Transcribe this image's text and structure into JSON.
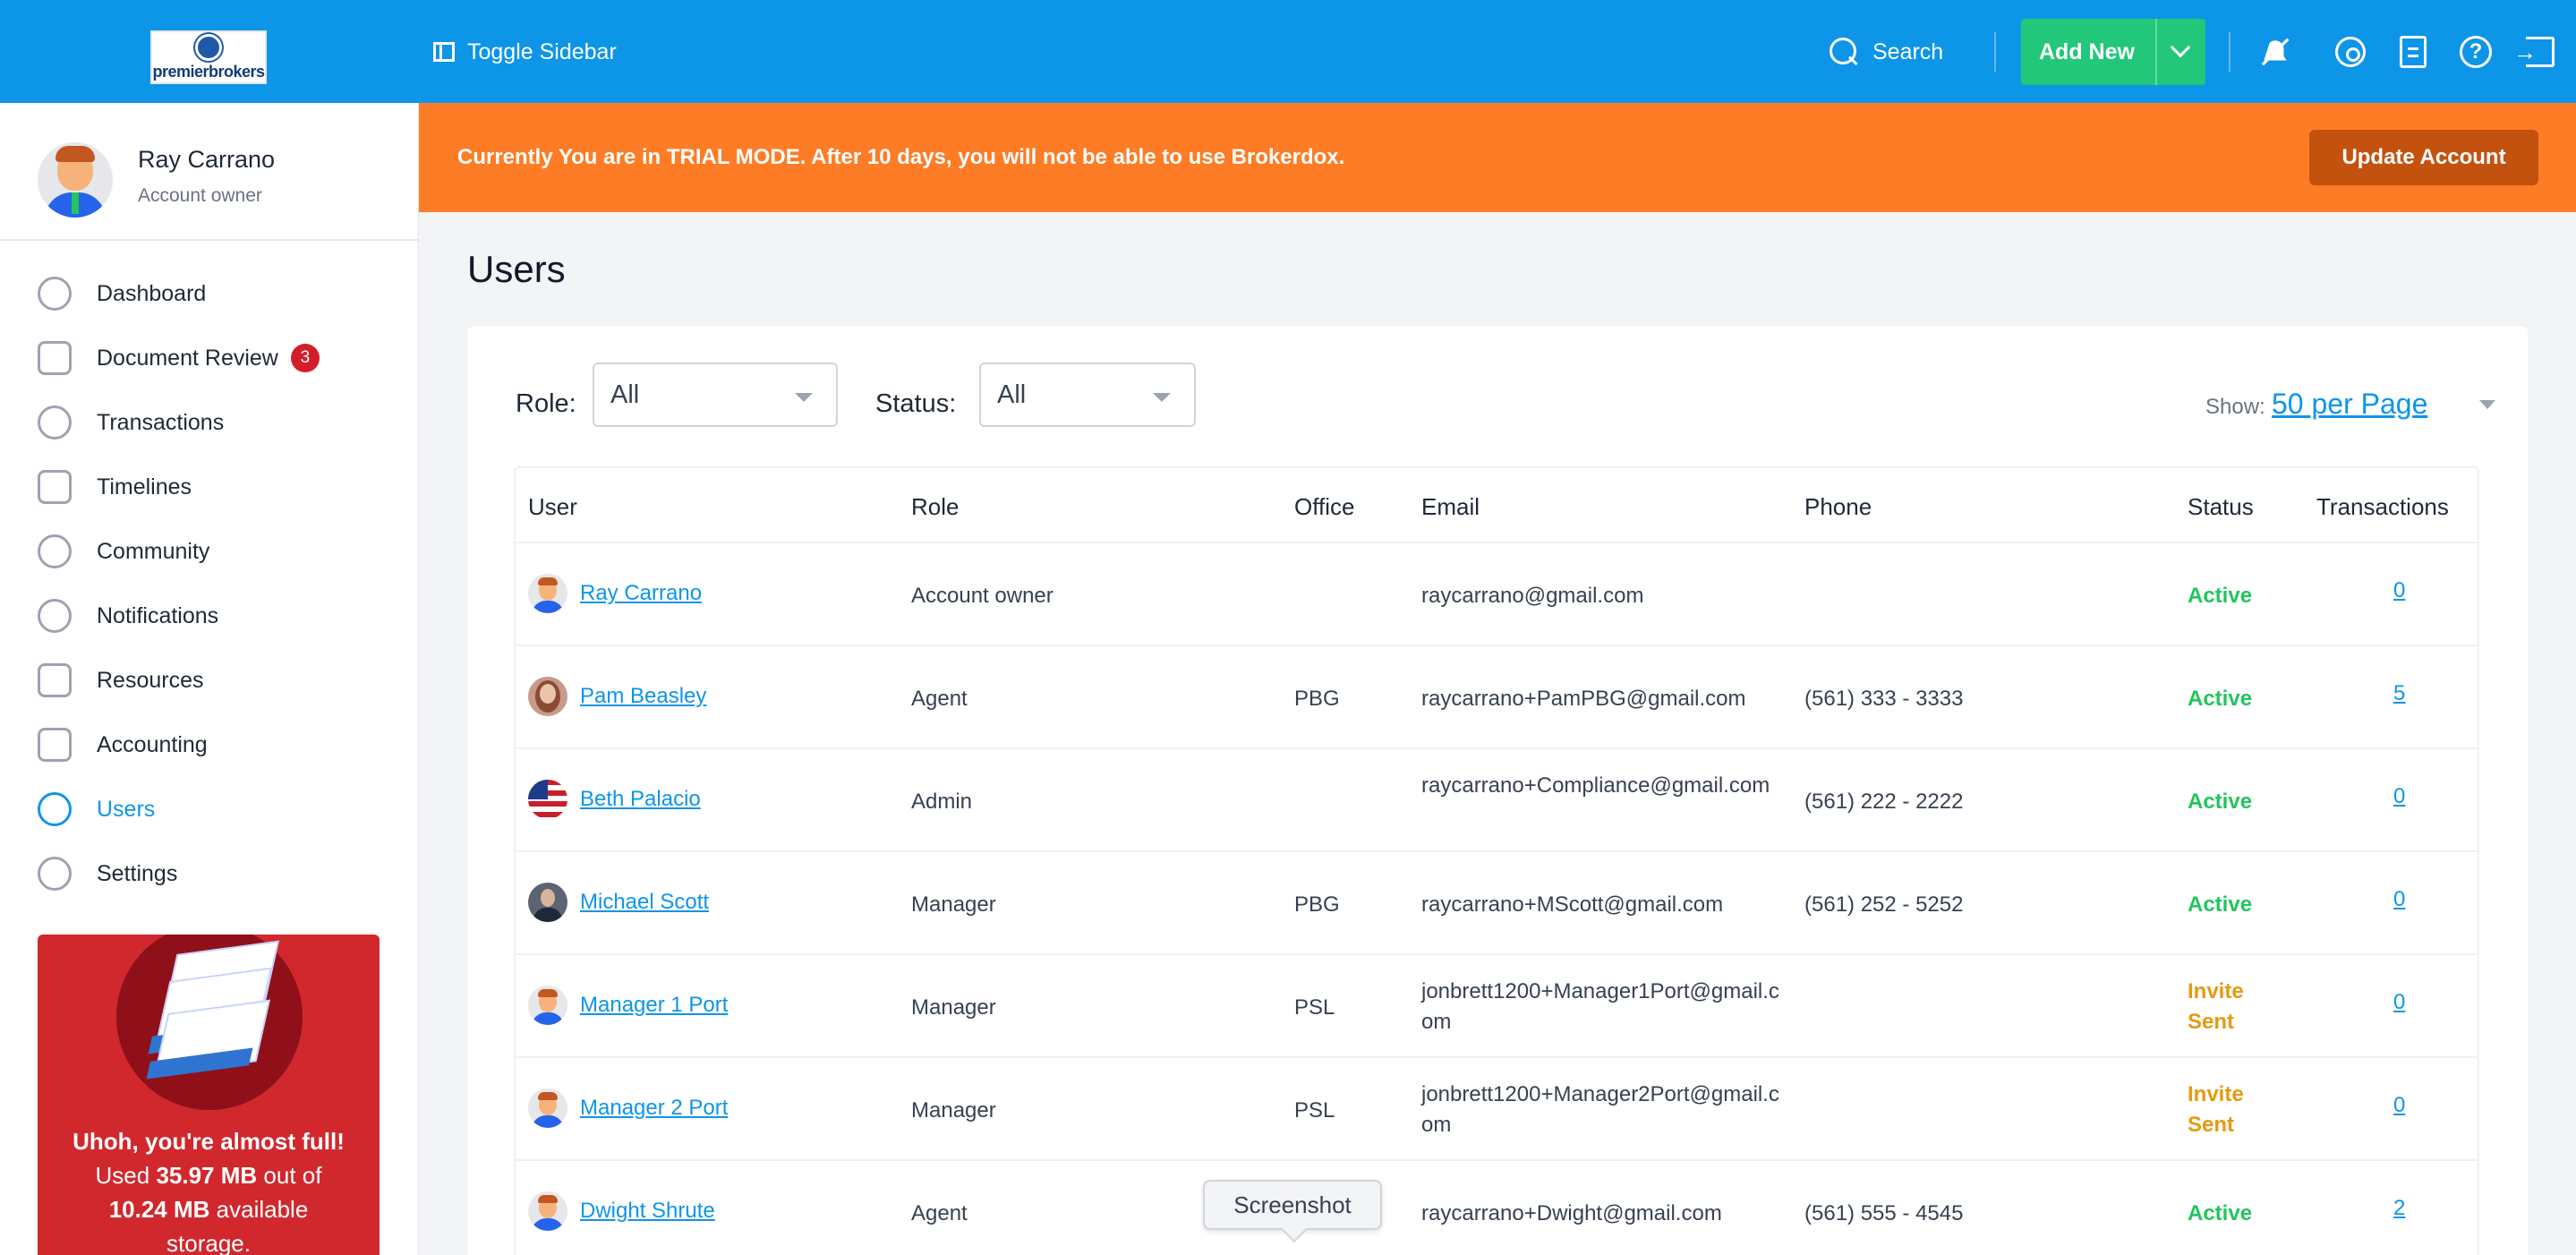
{
  "header": {
    "logo_text": "premierbrokers",
    "toggle_sidebar": "Toggle Sidebar",
    "search": "Search",
    "add_new": "Add New"
  },
  "profile": {
    "name": "Ray Carrano",
    "role": "Account owner"
  },
  "nav": [
    {
      "label": "Dashboard",
      "icon": "dashboard-icon"
    },
    {
      "label": "Document Review",
      "icon": "document-review-icon",
      "badge": "3"
    },
    {
      "label": "Transactions",
      "icon": "dollar-icon"
    },
    {
      "label": "Timelines",
      "icon": "timeline-icon"
    },
    {
      "label": "Community",
      "icon": "community-icon"
    },
    {
      "label": "Notifications",
      "icon": "chat-bubble-icon"
    },
    {
      "label": "Resources",
      "icon": "folder-icon"
    },
    {
      "label": "Accounting",
      "icon": "calculator-icon"
    },
    {
      "label": "Users",
      "icon": "user-icon",
      "active": true
    },
    {
      "label": "Settings",
      "icon": "gear-icon"
    }
  ],
  "storage": {
    "line1": "Uhoh, you're almost full!",
    "used_prefix": "Used ",
    "used": "35.97 MB",
    "out_of": " out of",
    "available": "10.24 MB",
    "available_suffix": " available",
    "storage_word": "storage."
  },
  "trial": {
    "message": "Currently You are in TRIAL MODE. After 10 days, you will not be able to use Brokerdox.",
    "button": "Update Account"
  },
  "page": {
    "title": "Users"
  },
  "filters": {
    "role_label": "Role:",
    "role_value": "All",
    "status_label": "Status:",
    "status_value": "All",
    "show_label": "Show:",
    "show_value": "50 per Page"
  },
  "table": {
    "columns": [
      "User",
      "Role",
      "Office",
      "Email",
      "Phone",
      "Status",
      "Transactions"
    ],
    "rows": [
      {
        "user": "Ray Carrano",
        "role": "Account owner",
        "office": "",
        "email": "raycarrano@gmail.com",
        "phone": "",
        "status": "Active",
        "transactions": "0"
      },
      {
        "user": "Pam Beasley",
        "role": "Agent",
        "office": "PBG",
        "email": "raycarrano+PamPBG@gmail.com",
        "phone": "(561) 333 - 3333",
        "status": "Active",
        "transactions": "5"
      },
      {
        "user": "Beth Palacio",
        "role": "Admin",
        "office": "",
        "email": "raycarrano+Compliance@gmail.com",
        "phone": "(561) 222 - 2222",
        "status": "Active",
        "transactions": "0"
      },
      {
        "user": "Michael Scott",
        "role": "Manager",
        "office": "PBG",
        "email": "raycarrano+MScott@gmail.com",
        "phone": "(561) 252 - 5252",
        "status": "Active",
        "transactions": "0"
      },
      {
        "user": "Manager 1 Port",
        "role": "Manager",
        "office": "PSL",
        "email": "jonbrett1200+Manager1Port@gmail.com",
        "phone": "",
        "status": "Invite Sent",
        "transactions": "0"
      },
      {
        "user": "Manager 2 Port",
        "role": "Manager",
        "office": "PSL",
        "email": "jonbrett1200+Manager2Port@gmail.com",
        "phone": "",
        "status": "Invite Sent",
        "transactions": "0"
      },
      {
        "user": "Dwight Shrute",
        "role": "Agent",
        "office": "",
        "email": "raycarrano+Dwight@gmail.com",
        "phone": "(561) 555 - 4545",
        "status": "Active",
        "transactions": "2"
      }
    ]
  },
  "tooltip": {
    "text": "Screenshot"
  },
  "colors": {
    "topbar": "#0d95e8",
    "trial_banner": "#fd7c25",
    "add_new": "#22c77a",
    "storage_alert": "#d0282d",
    "active_status": "#22c55e",
    "invite_status": "#e49b0f"
  }
}
